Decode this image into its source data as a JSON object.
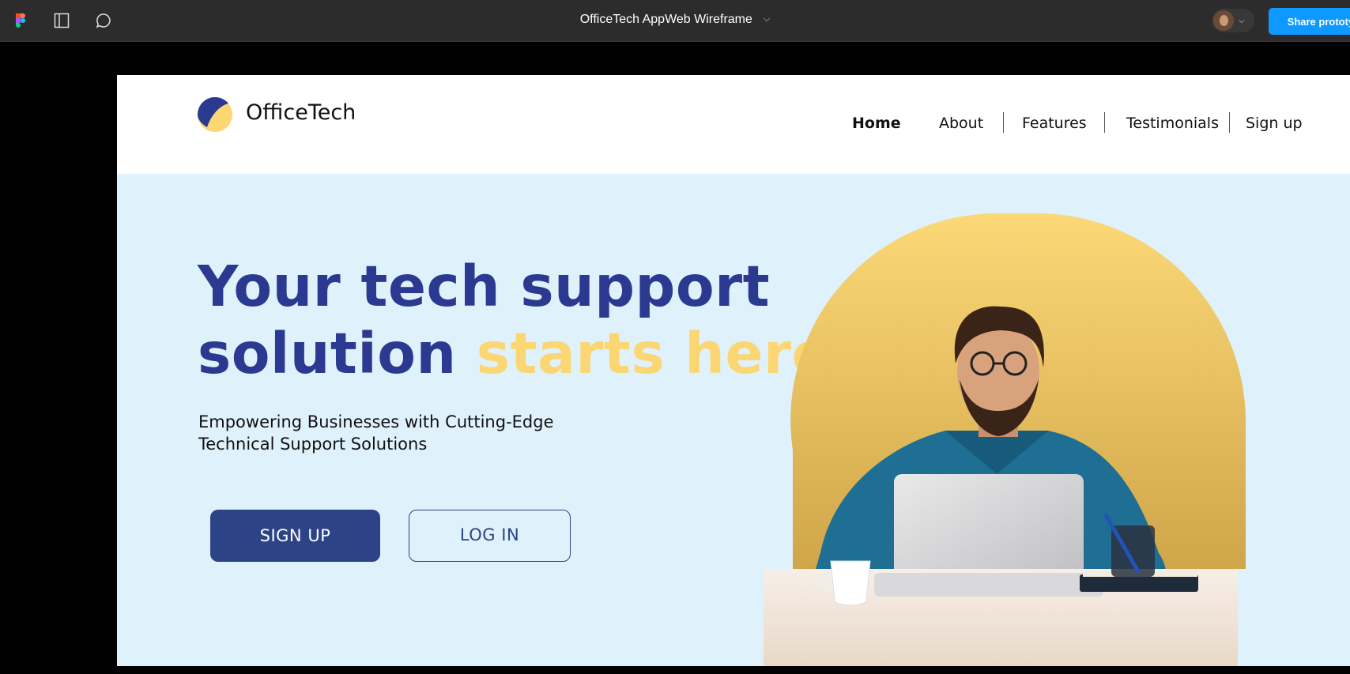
{
  "figma": {
    "file_title": "OfficeTech AppWeb Wireframe",
    "share_label": "Share prototype",
    "icons": [
      "figma-logo-icon",
      "panel-toggle-icon",
      "comment-icon",
      "chevron-down-icon"
    ]
  },
  "site": {
    "brand": "OfficeTech",
    "nav": [
      {
        "label": "Home",
        "active": true
      },
      {
        "label": "About",
        "active": false
      },
      {
        "label": "Features",
        "active": false
      },
      {
        "label": "Testimonials",
        "active": false
      },
      {
        "label": "Sign up",
        "active": false
      }
    ],
    "hero": {
      "headline_line1": "Your tech support",
      "headline_line2_start": "solution ",
      "headline_line2_accent": "starts here",
      "subtitle": "Empowering Businesses with Cutting-Edge Technical Support Solutions",
      "primary_button": "SIGN UP",
      "secondary_button": "LOG IN"
    },
    "colors": {
      "primary": "#2b3990",
      "accent": "#fbd672",
      "hero_bg": "#dff1fb",
      "button": "#2c4387"
    }
  }
}
